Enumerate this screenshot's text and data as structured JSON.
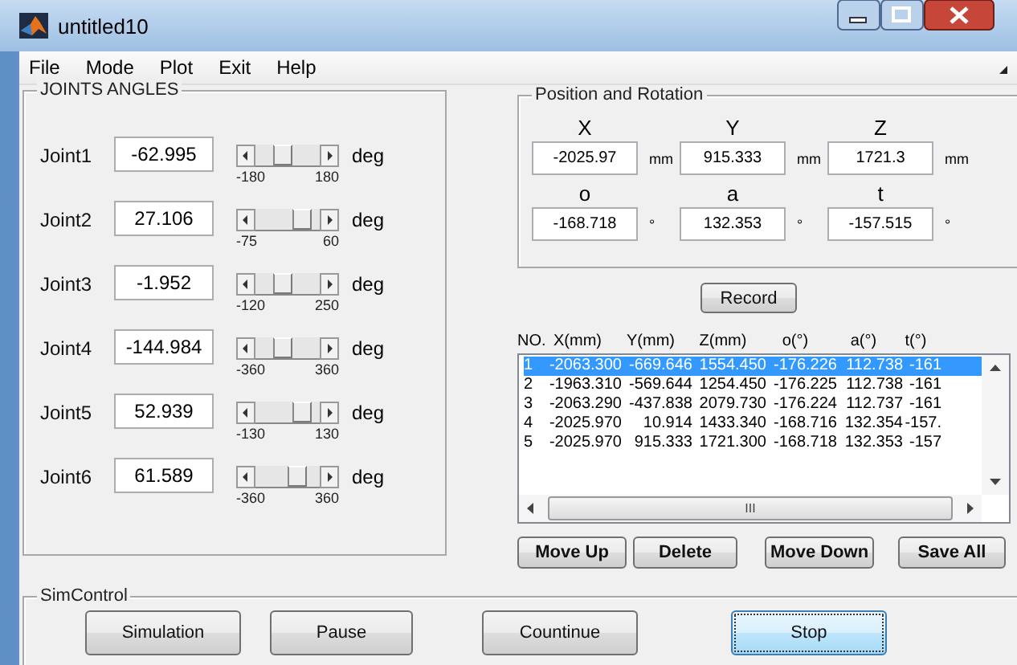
{
  "window": {
    "title": "untitled10"
  },
  "menu": [
    "File",
    "Mode",
    "Plot",
    "Exit",
    "Help"
  ],
  "joints_panel": {
    "title": "JOINTS ANGLES",
    "joints": [
      {
        "label": "Joint1",
        "value": "-62.995",
        "level": 0.4,
        "min": "-180",
        "max": "180",
        "unit": "deg"
      },
      {
        "label": "Joint2",
        "value": "27.106",
        "level": 0.82,
        "min": "-75",
        "max": "60",
        "unit": "deg"
      },
      {
        "label": "Joint3",
        "value": "-1.952",
        "level": 0.4,
        "min": "-120",
        "max": "250",
        "unit": "deg"
      },
      {
        "label": "Joint4",
        "value": "-144.984",
        "level": 0.4,
        "min": "-360",
        "max": "360",
        "unit": "deg"
      },
      {
        "label": "Joint5",
        "value": "52.939",
        "level": 0.82,
        "min": "-130",
        "max": "130",
        "unit": "deg"
      },
      {
        "label": "Joint6",
        "value": "61.589",
        "level": 0.7,
        "min": "-360",
        "max": "360",
        "unit": "deg"
      }
    ]
  },
  "pose_panel": {
    "title": "Position and Rotation",
    "fields": [
      {
        "label": "X",
        "value": "-2025.97",
        "unit": "mm"
      },
      {
        "label": "Y",
        "value": "915.333",
        "unit": "mm"
      },
      {
        "label": "Z",
        "value": "1721.3",
        "unit": "mm"
      },
      {
        "label": "o",
        "value": "-168.718",
        "unit": "°"
      },
      {
        "label": "a",
        "value": "132.353",
        "unit": "°"
      },
      {
        "label": "t",
        "value": "-157.515",
        "unit": "°"
      }
    ]
  },
  "record_button": "Record",
  "table": {
    "columns": [
      "NO.",
      "X(mm)",
      "Y(mm)",
      "Z(mm)",
      "o(°)",
      "a(°)",
      "t(°)"
    ],
    "rows": [
      {
        "cells": [
          "1",
          "-2063.300",
          "-669.646",
          "1554.450",
          "-176.226",
          "112.738",
          "-161"
        ],
        "selected": true
      },
      {
        "cells": [
          "2",
          "-1963.310",
          "-569.644",
          "1254.450",
          "-176.225",
          "112.738",
          "-161"
        ],
        "selected": false
      },
      {
        "cells": [
          "3",
          "-2063.290",
          "-437.838",
          "2079.730",
          "-176.224",
          "112.737",
          "-161"
        ],
        "selected": false
      },
      {
        "cells": [
          "4",
          "-2025.970",
          "10.914",
          "1433.340",
          "-168.716",
          "132.354",
          "-157."
        ],
        "selected": false
      },
      {
        "cells": [
          "5",
          "-2025.970",
          "915.333",
          "1721.300",
          "-168.718",
          "132.353",
          "-157"
        ],
        "selected": false
      }
    ],
    "scrollbar_grip": "III"
  },
  "table_buttons": [
    "Move Up",
    "Delete",
    "Move Down",
    "Save All"
  ],
  "sim_control": {
    "title": "SimControl",
    "buttons": [
      {
        "label": "Simulation",
        "focused": false
      },
      {
        "label": "Pause",
        "focused": false
      },
      {
        "label": "Countinue",
        "focused": false
      },
      {
        "label": "Stop",
        "focused": true
      }
    ]
  }
}
